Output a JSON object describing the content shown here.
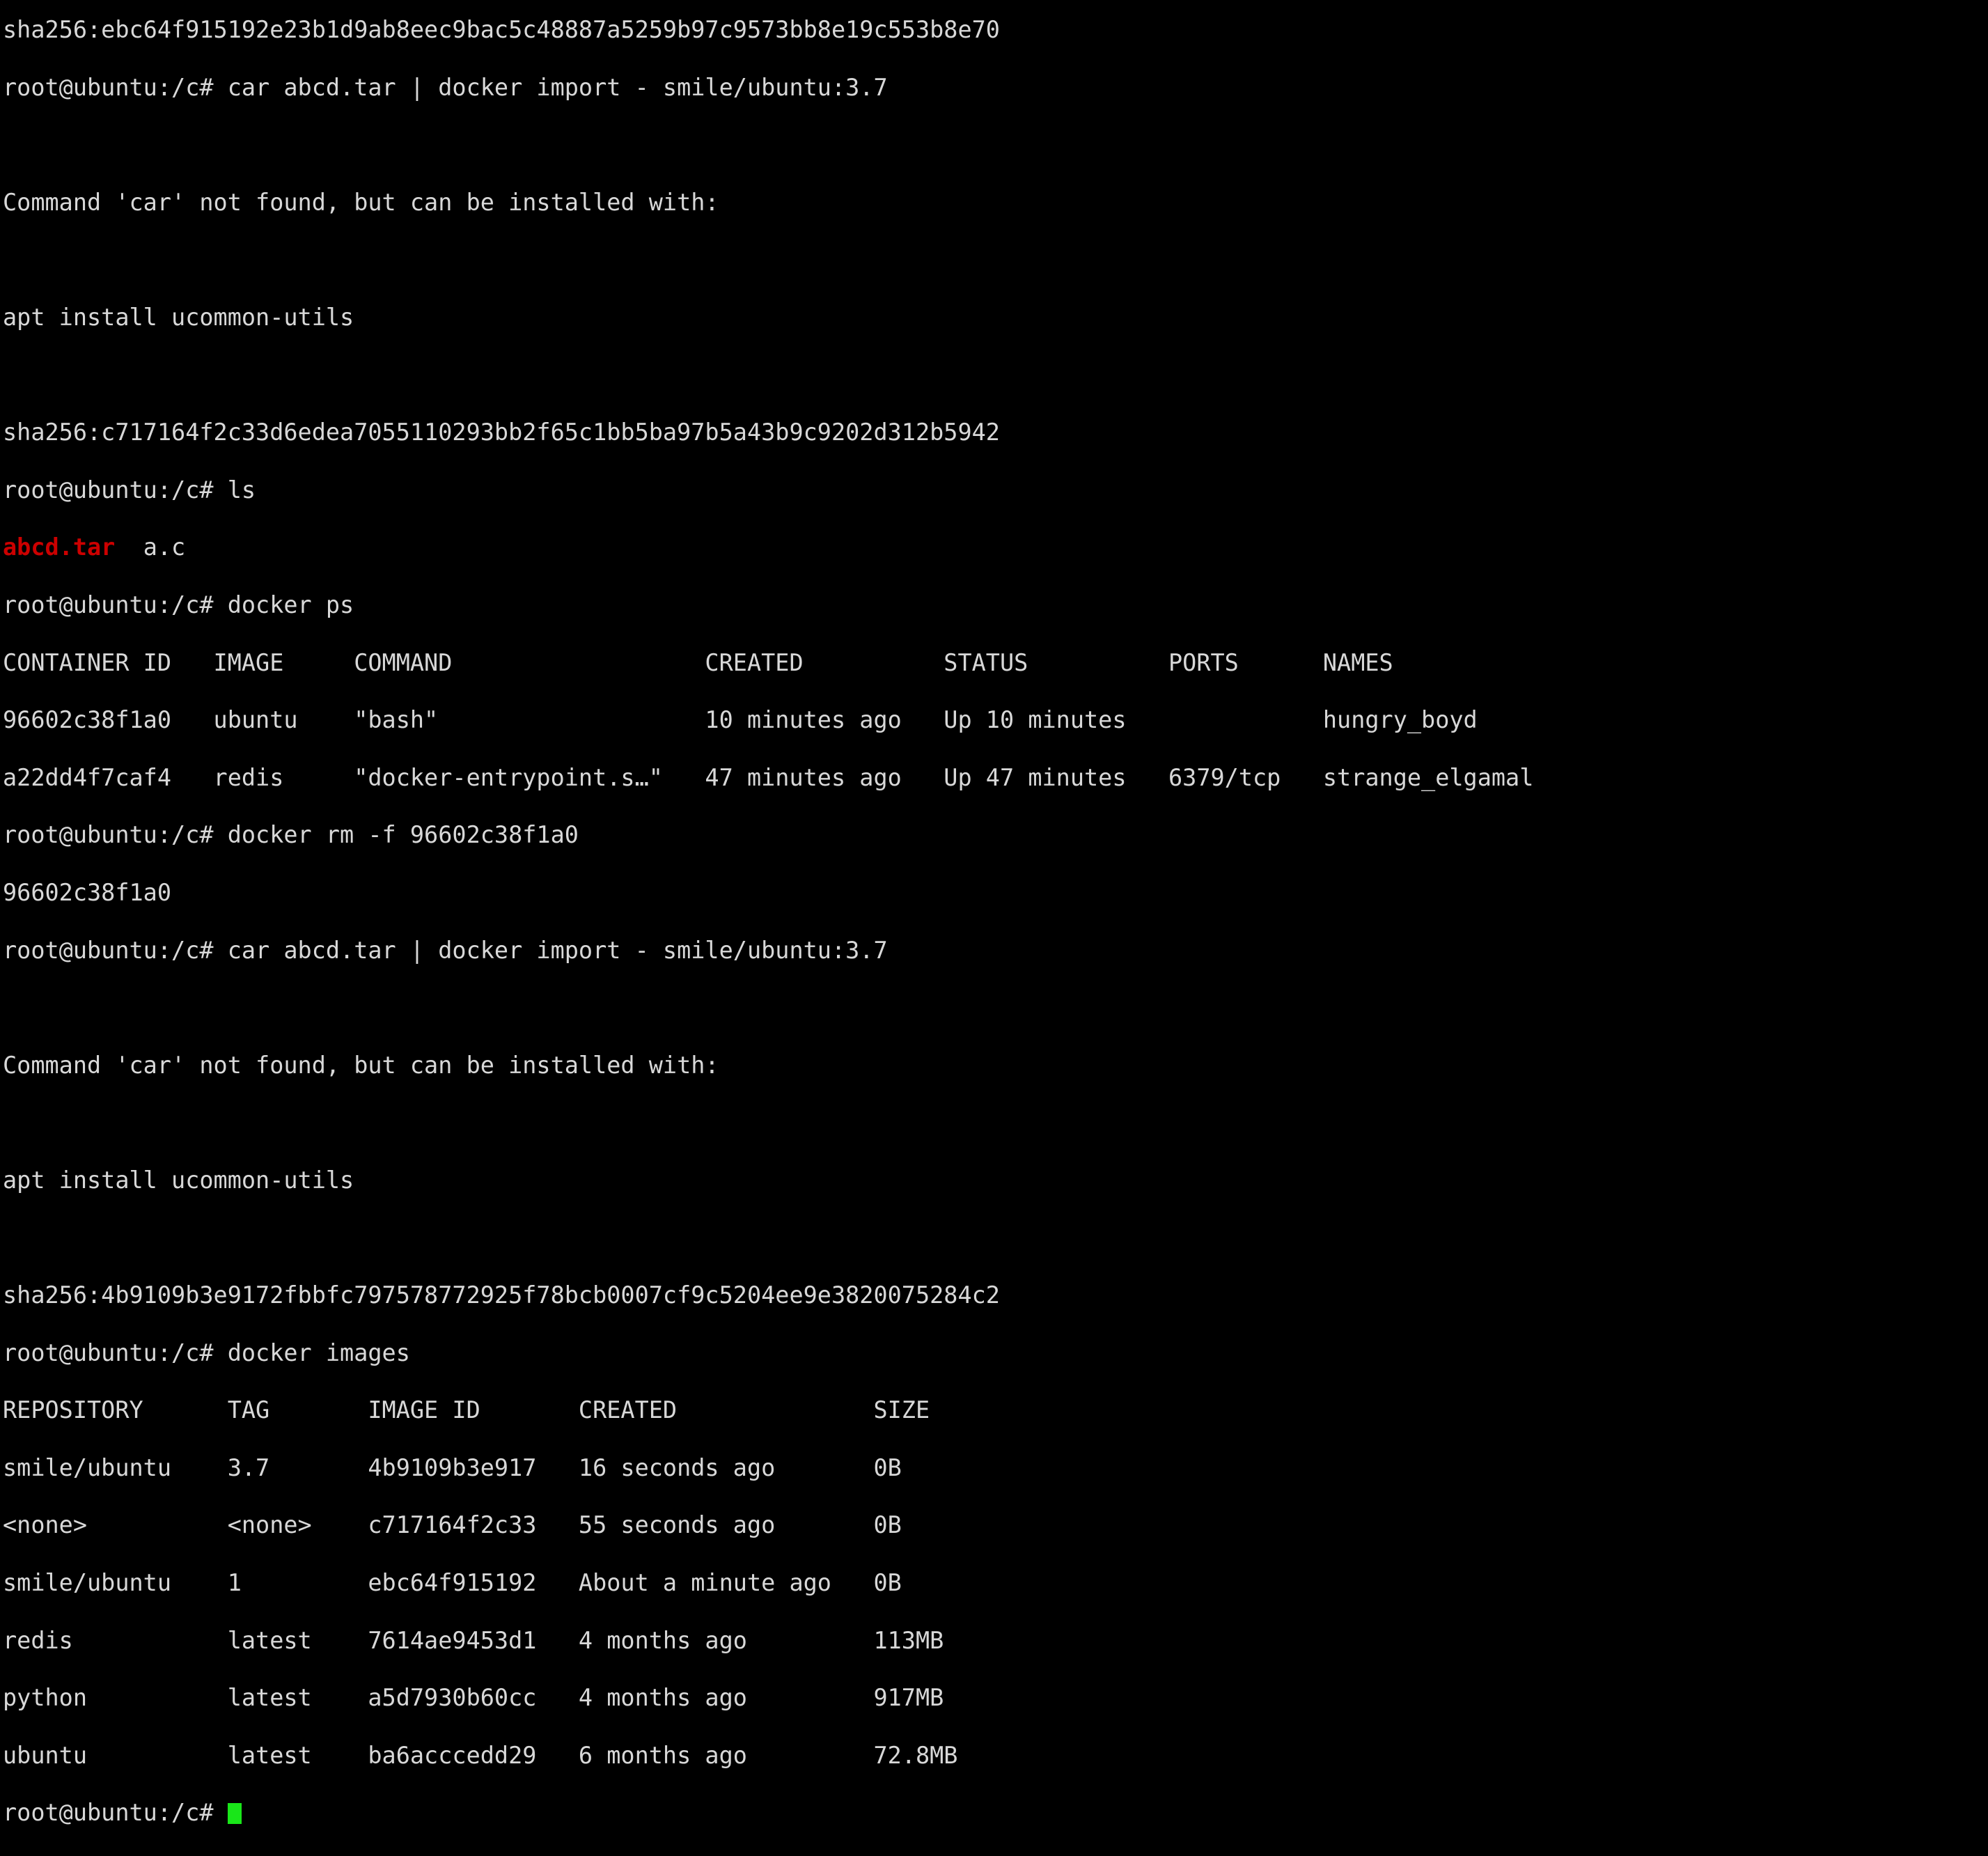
{
  "terminal": {
    "background_color": "#000000",
    "foreground_color": "#d8d8d8",
    "highlight_red": "#cc0000",
    "cursor_color": "#19e619",
    "prompt": "root@ubuntu:/c# ",
    "lines": [
      {
        "id": "line-0",
        "text": "sha256:ebc64f915192e23b1d9ab8eec9bac5c48887a5259b97c9573bb8e19c553b8e70"
      },
      {
        "id": "line-1",
        "text": "root@ubuntu:/c# car abcd.tar | docker import - smile/ubuntu:3.7"
      },
      {
        "id": "line-2",
        "text": ""
      },
      {
        "id": "line-3",
        "text": "Command 'car' not found, but can be installed with:"
      },
      {
        "id": "line-4",
        "text": ""
      },
      {
        "id": "line-5",
        "text": "apt install ucommon-utils"
      },
      {
        "id": "line-6",
        "text": ""
      },
      {
        "id": "line-7",
        "text": "sha256:c717164f2c33d6edea7055110293bb2f65c1bb5ba97b5a43b9c9202d312b5942"
      },
      {
        "id": "line-8",
        "text": "root@ubuntu:/c# ls"
      },
      {
        "id": "line-9",
        "segments": [
          {
            "text": "abcd.tar",
            "color": "red"
          },
          {
            "text": "  a.c",
            "color": "default"
          }
        ]
      },
      {
        "id": "line-10",
        "text": "root@ubuntu:/c# docker ps"
      },
      {
        "id": "line-11",
        "text": "CONTAINER ID   IMAGE     COMMAND                  CREATED          STATUS          PORTS      NAMES"
      },
      {
        "id": "line-12",
        "text": "96602c38f1a0   ubuntu    \"bash\"                   10 minutes ago   Up 10 minutes              hungry_boyd"
      },
      {
        "id": "line-13",
        "text": "a22dd4f7caf4   redis     \"docker-entrypoint.s…\"   47 minutes ago   Up 47 minutes   6379/tcp   strange_elgamal"
      },
      {
        "id": "line-14",
        "text": "root@ubuntu:/c# docker rm -f 96602c38f1a0"
      },
      {
        "id": "line-15",
        "text": "96602c38f1a0"
      },
      {
        "id": "line-16",
        "text": "root@ubuntu:/c# car abcd.tar | docker import - smile/ubuntu:3.7"
      },
      {
        "id": "line-17",
        "text": ""
      },
      {
        "id": "line-18",
        "text": "Command 'car' not found, but can be installed with:"
      },
      {
        "id": "line-19",
        "text": ""
      },
      {
        "id": "line-20",
        "text": "apt install ucommon-utils"
      },
      {
        "id": "line-21",
        "text": ""
      },
      {
        "id": "line-22",
        "text": "sha256:4b9109b3e9172fbbfc797578772925f78bcb0007cf9c5204ee9e3820075284c2"
      },
      {
        "id": "line-23",
        "text": "root@ubuntu:/c# docker images"
      },
      {
        "id": "line-24",
        "text": "REPOSITORY      TAG       IMAGE ID       CREATED              SIZE"
      },
      {
        "id": "line-25",
        "text": "smile/ubuntu    3.7       4b9109b3e917   16 seconds ago       0B"
      },
      {
        "id": "line-26",
        "text": "<none>          <none>    c717164f2c33   55 seconds ago       0B"
      },
      {
        "id": "line-27",
        "text": "smile/ubuntu    1         ebc64f915192   About a minute ago   0B"
      },
      {
        "id": "line-28",
        "text": "redis           latest    7614ae9453d1   4 months ago         113MB"
      },
      {
        "id": "line-29",
        "text": "python          latest    a5d7930b60cc   4 months ago         917MB"
      },
      {
        "id": "line-30",
        "text": "ubuntu          latest    ba6acccedd29   6 months ago         72.8MB"
      },
      {
        "id": "line-31",
        "segments": [
          {
            "text": "root@ubuntu:/c# ",
            "color": "default"
          }
        ],
        "cursor": true
      }
    ],
    "docker_ps": {
      "columns": [
        "CONTAINER ID",
        "IMAGE",
        "COMMAND",
        "CREATED",
        "STATUS",
        "PORTS",
        "NAMES"
      ],
      "rows": [
        [
          "96602c38f1a0",
          "ubuntu",
          "\"bash\"",
          "10 minutes ago",
          "Up 10 minutes",
          "",
          "hungry_boyd"
        ],
        [
          "a22dd4f7caf4",
          "redis",
          "\"docker-entrypoint.s…\"",
          "47 minutes ago",
          "Up 47 minutes",
          "6379/tcp",
          "strange_elgamal"
        ]
      ]
    },
    "docker_images": {
      "columns": [
        "REPOSITORY",
        "TAG",
        "IMAGE ID",
        "CREATED",
        "SIZE"
      ],
      "rows": [
        [
          "smile/ubuntu",
          "3.7",
          "4b9109b3e917",
          "16 seconds ago",
          "0B"
        ],
        [
          "<none>",
          "<none>",
          "c717164f2c33",
          "55 seconds ago",
          "0B"
        ],
        [
          "smile/ubuntu",
          "1",
          "ebc64f915192",
          "About a minute ago",
          "0B"
        ],
        [
          "redis",
          "latest",
          "7614ae9453d1",
          "4 months ago",
          "113MB"
        ],
        [
          "python",
          "latest",
          "a5d7930b60cc",
          "4 months ago",
          "917MB"
        ],
        [
          "ubuntu",
          "latest",
          "ba6acccedd29",
          "6 months ago",
          "72.8MB"
        ]
      ]
    },
    "ls_output": [
      "abcd.tar",
      "a.c"
    ],
    "commands_entered": [
      "car abcd.tar | docker import - smile/ubuntu:3.7",
      "ls",
      "docker ps",
      "docker rm -f 96602c38f1a0",
      "car abcd.tar | docker import - smile/ubuntu:3.7",
      "docker images"
    ]
  }
}
